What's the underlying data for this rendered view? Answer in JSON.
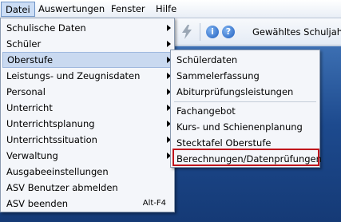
{
  "menubar": {
    "items": [
      {
        "label": "Datei"
      },
      {
        "label": "Auswertungen"
      },
      {
        "label": "Fenster"
      },
      {
        "label": "Hilfe"
      }
    ]
  },
  "toolbar": {
    "lightning_icon": "lightning-icon",
    "info_icon": "info-icon",
    "help_icon": "help-icon",
    "info_glyph": "i",
    "help_glyph": "?",
    "school_year_label": "Gewähltes Schuljahr"
  },
  "datei_menu": {
    "items": [
      {
        "label": "Schulische Daten",
        "submenu": true
      },
      {
        "label": "Schüler",
        "submenu": true
      },
      {
        "label": "Oberstufe",
        "submenu": true,
        "highlighted": true
      },
      {
        "label": "Leistungs- und Zeugnisdaten",
        "submenu": true
      },
      {
        "label": "Personal",
        "submenu": true
      },
      {
        "label": "Unterricht",
        "submenu": true
      },
      {
        "label": "Unterrichtsplanung",
        "submenu": true
      },
      {
        "label": "Unterrichtssituation",
        "submenu": true
      },
      {
        "label": "Verwaltung",
        "submenu": true
      },
      {
        "label": "Ausgabeeinstellungen",
        "submenu": false
      },
      {
        "label": "ASV Benutzer abmelden",
        "submenu": false
      },
      {
        "label": "ASV beenden",
        "submenu": false,
        "shortcut": "Alt-F4"
      }
    ]
  },
  "oberstufe_menu": {
    "items": [
      {
        "label": "Schülerdaten"
      },
      {
        "label": "Sammelerfassung"
      },
      {
        "label": "Abiturprüfungsleistungen"
      },
      {
        "label": "Fachangebot"
      },
      {
        "label": "Kurs- und Schienenplanung"
      },
      {
        "label": "Stecktafel Oberstufe"
      },
      {
        "label": "Berechnungen/Datenprüfungen",
        "outlined": true
      }
    ]
  },
  "colors": {
    "highlight": "#c9d9f0",
    "outline": "#c0141c",
    "background": "#1d4a8e"
  }
}
